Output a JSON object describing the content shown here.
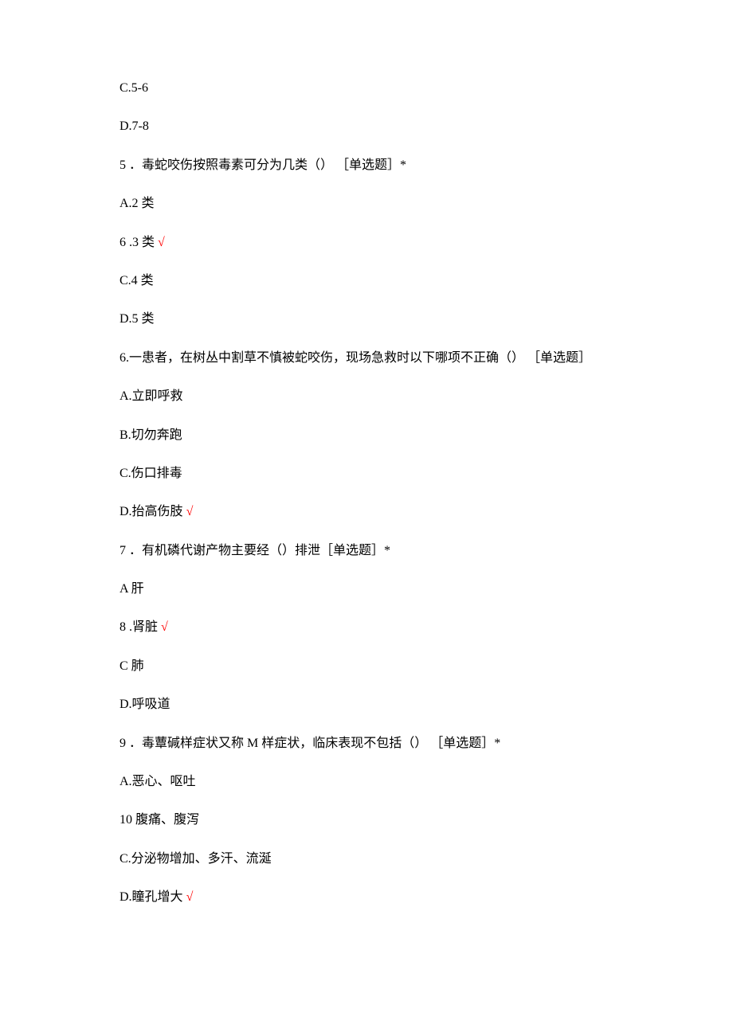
{
  "lines": [
    {
      "text": "C.5-6",
      "correct": false
    },
    {
      "text": "D.7-8",
      "correct": false
    },
    {
      "text": "5 ．毒蛇咬伤按照毒素可分为几类（） ［单选题］*",
      "correct": false
    },
    {
      "text": "A.2 类",
      "correct": false
    },
    {
      "text": "6  .3 类",
      "correct": true
    },
    {
      "text": "C.4 类",
      "correct": false
    },
    {
      "text": "D.5 类",
      "correct": false
    },
    {
      "text": "6.一患者，在树丛中割草不慎被蛇咬伤，现场急救时以下哪项不正确（） ［单选题］",
      "correct": false
    },
    {
      "text": "A.立即呼救",
      "correct": false
    },
    {
      "text": "B.切勿奔跑",
      "correct": false
    },
    {
      "text": "C.伤口排毒",
      "correct": false
    },
    {
      "text": "D.抬高伤肢",
      "correct": true
    },
    {
      "text": "7 ．有机磷代谢产物主要经（）排泄［单选题］*",
      "correct": false
    },
    {
      "text": "A 肝",
      "correct": false
    },
    {
      "text": "8  .肾脏",
      "correct": true
    },
    {
      "text": "C 肺",
      "correct": false
    },
    {
      "text": "D.呼吸道",
      "correct": false
    },
    {
      "text": "9 ．毒蕈碱样症状又称 M 样症状，临床表现不包括（） ［单选题］*",
      "correct": false
    },
    {
      "text": "A.恶心、呕吐",
      "correct": false
    },
    {
      "text": "10  腹痛、腹泻",
      "correct": false
    },
    {
      "text": "C.分泌物增加、多汗、流涎",
      "correct": false
    },
    {
      "text": "D.瞳孔增大",
      "correct": true
    }
  ],
  "correct_mark": "√"
}
